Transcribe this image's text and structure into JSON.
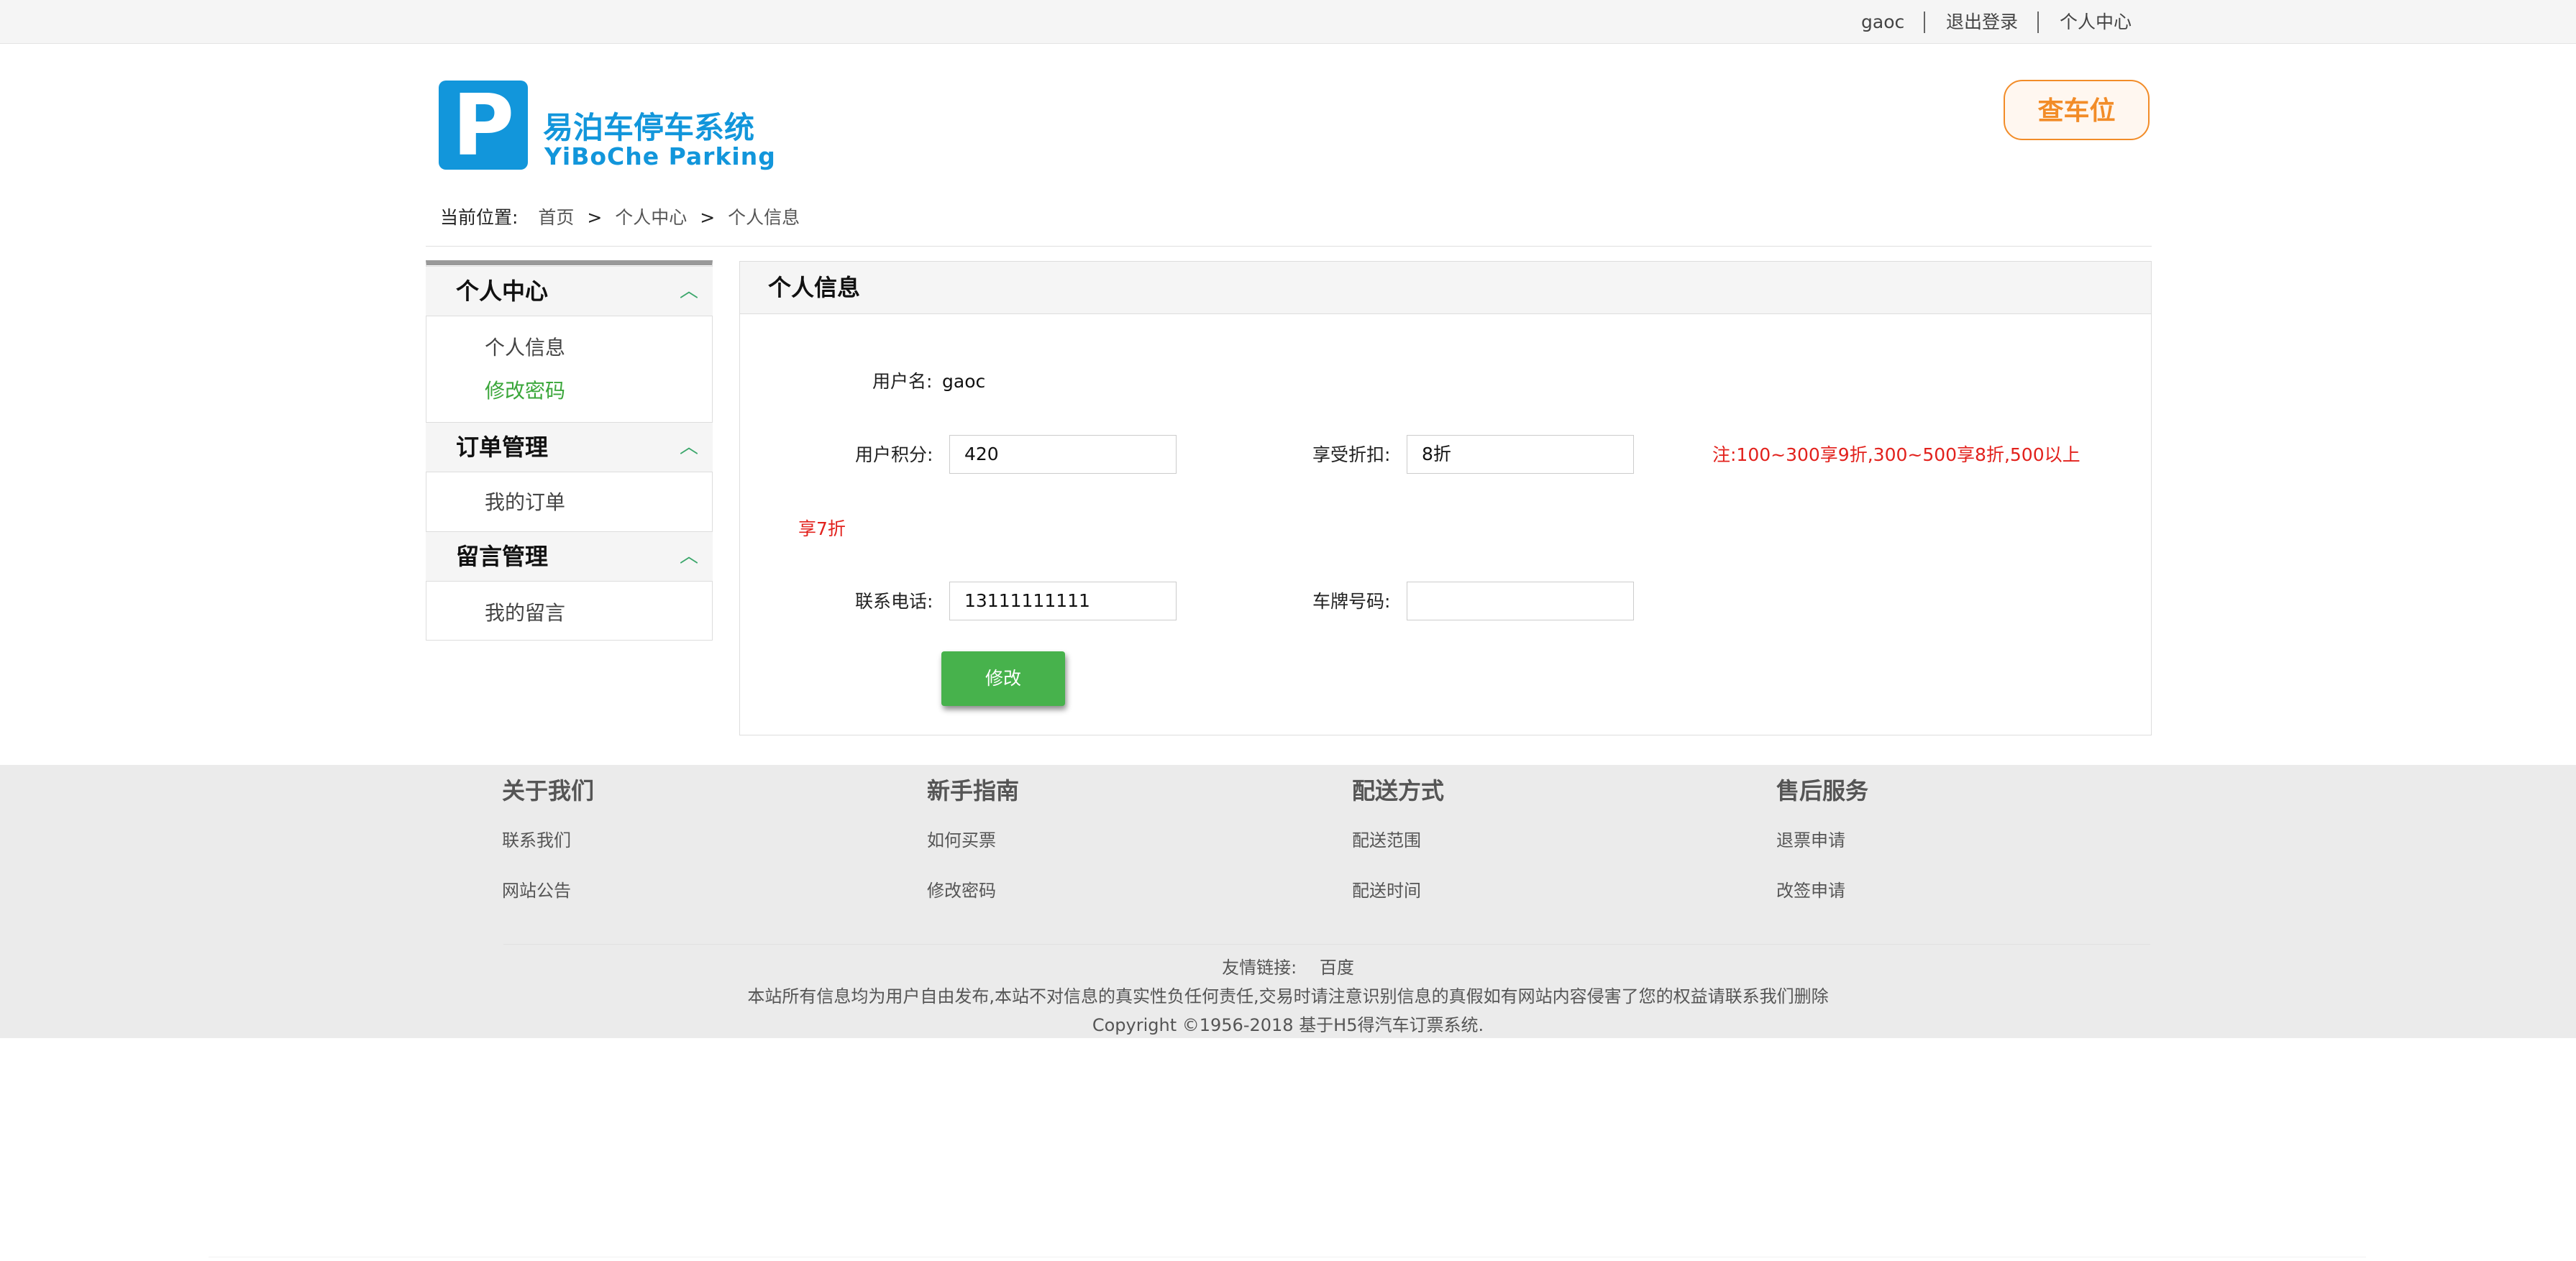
{
  "topbar": {
    "username": "gaoc",
    "logout": "退出登录",
    "user_center": "个人中心"
  },
  "logo": {
    "letter": "P",
    "name_cn": "易泊车停车系统",
    "name_en": "YiBoChe  Parking"
  },
  "find_parking_label": "查车位",
  "breadcrumb": {
    "label": "当前位置:",
    "items": [
      "首页",
      "个人中心",
      "个人信息"
    ],
    "separator": ">"
  },
  "sidebar": {
    "sections": [
      {
        "title": "个人中心",
        "items": [
          "个人信息",
          "修改密码"
        ]
      },
      {
        "title": "订单管理",
        "items": [
          "我的订单"
        ]
      },
      {
        "title": "留言管理",
        "items": [
          "我的留言"
        ]
      }
    ],
    "active_item_color": "#3aa63a"
  },
  "profile": {
    "title": "个人信息",
    "username_label": "用户名:",
    "username_value": "gaoc",
    "points_label": "用户积分:",
    "points_value": "420",
    "discount_label": "享受折扣:",
    "discount_value": "8折",
    "note_line1": "注:100~300享9折,300~500享8折,500以上",
    "note_line2": "享7折",
    "phone_label": "联系电话:",
    "phone_value": "13111111111",
    "plate_label": "车牌号码:",
    "plate_value": "",
    "submit_label": "修改"
  },
  "footer": {
    "columns": [
      {
        "title": "关于我们",
        "links": [
          "联系我们",
          "网站公告"
        ]
      },
      {
        "title": "新手指南",
        "links": [
          "如何买票",
          "修改密码"
        ]
      },
      {
        "title": "配送方式",
        "links": [
          "配送范围",
          "配送时间"
        ]
      },
      {
        "title": "售后服务",
        "links": [
          "退票申请",
          "改签申请"
        ]
      }
    ],
    "friend_links_label": "友情链接:",
    "friend_link": "百度",
    "disclaimer": "本站所有信息均为用户自由发布,本站不对信息的真实性负任何责任,交易时请注意识别信息的真假如有网站内容侵害了您的权益请联系我们删除",
    "copyright": "Copyright ©1956-2018 基于H5得汽车订票系统."
  },
  "colors": {
    "brand_blue": "#1296db",
    "accent_orange": "#f28c28",
    "button_green": "#47b24c",
    "note_red": "#e2211c"
  }
}
